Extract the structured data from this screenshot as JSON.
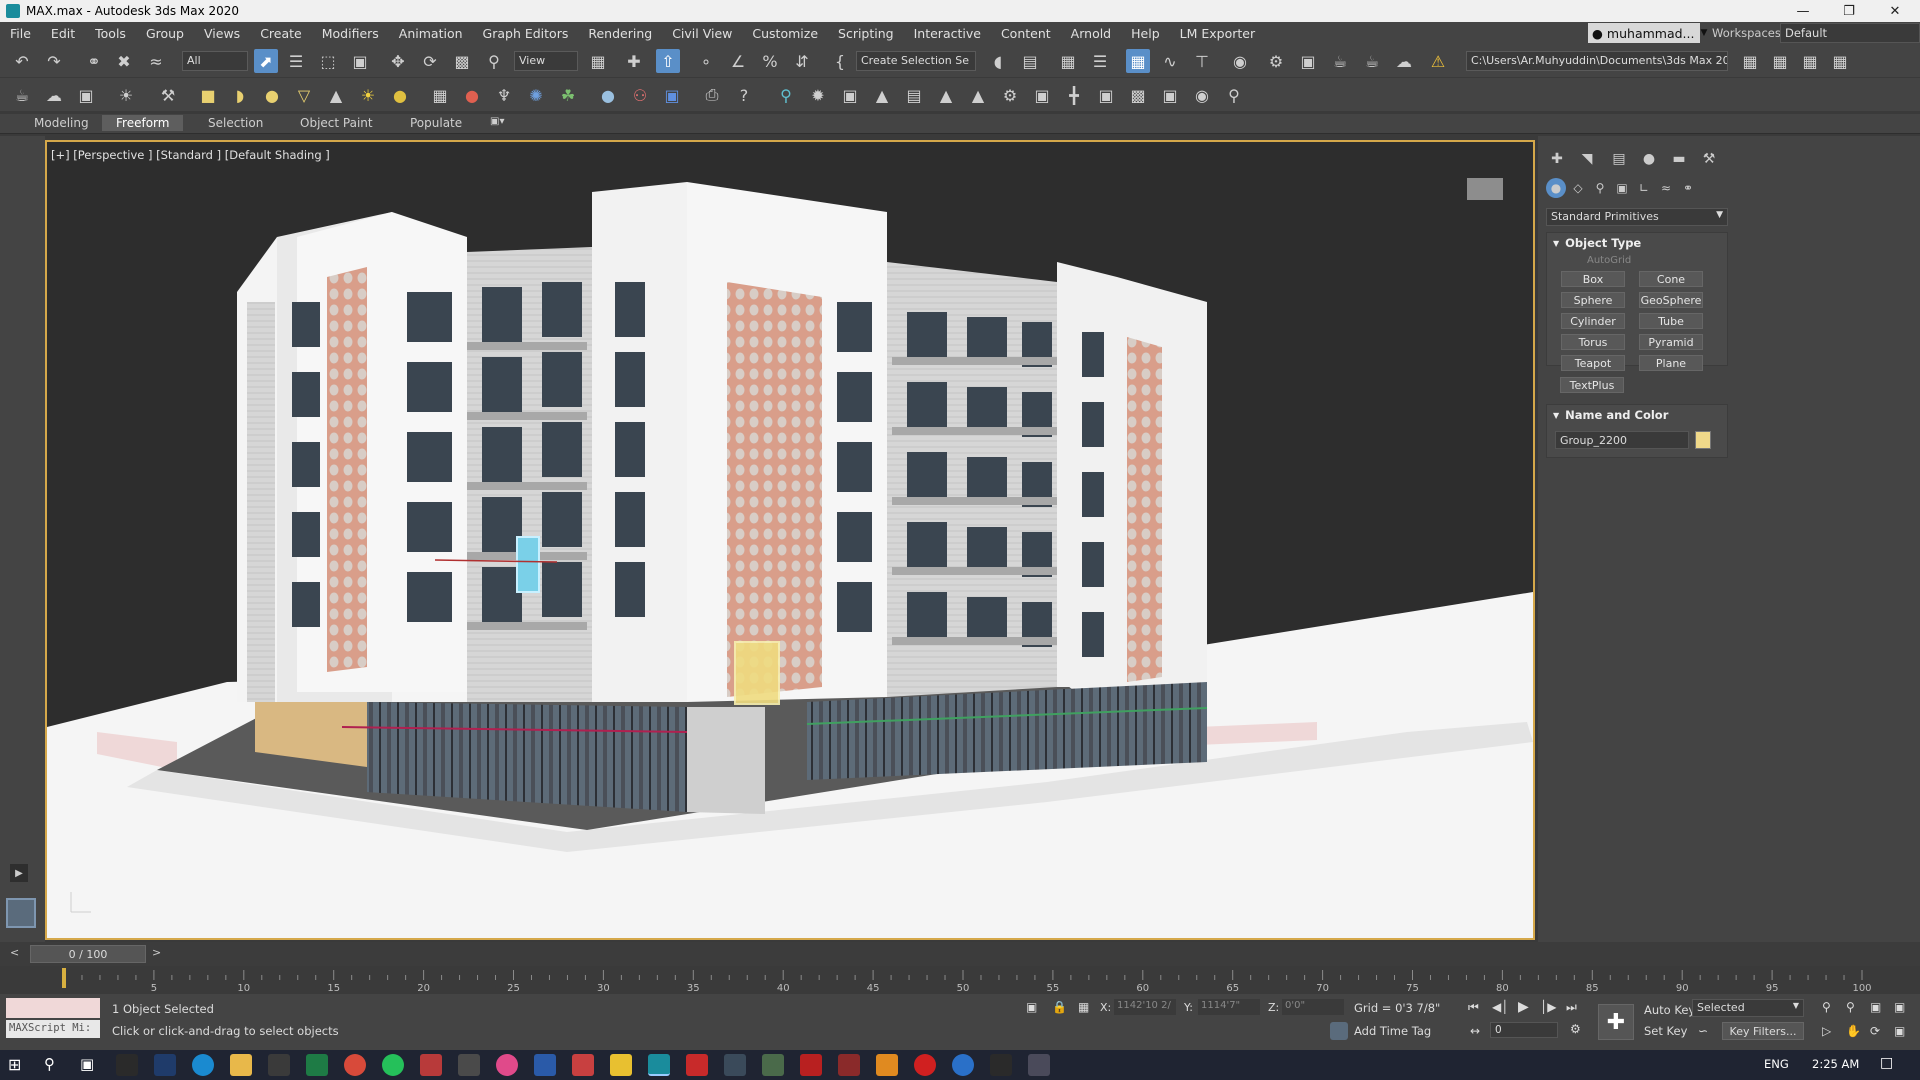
{
  "window": {
    "title": "MAX.max - Autodesk 3ds Max 2020"
  },
  "menu": {
    "items": [
      "File",
      "Edit",
      "Tools",
      "Group",
      "Views",
      "Create",
      "Modifiers",
      "Animation",
      "Graph Editors",
      "Rendering",
      "Civil View",
      "Customize",
      "Scripting",
      "Interactive",
      "Content",
      "Arnold",
      "Help",
      "LM Exporter"
    ],
    "user": "muhammad...",
    "workspaces_label": "Workspaces:",
    "workspaces_value": "Default"
  },
  "toolbar": {
    "filter": "All",
    "ref_coord": "View",
    "selection_set": "Create Selection Se",
    "project_path": "C:\\Users\\Ar.Muhyuddin\\Documents\\3ds Max 2020"
  },
  "ribbon": {
    "tabs": [
      "Modeling",
      "Freeform",
      "Selection",
      "Object Paint",
      "Populate"
    ],
    "active": "Freeform"
  },
  "viewport": {
    "label": "[+] [Perspective ] [Standard ] [Default Shading ]"
  },
  "command_panel": {
    "category": "Standard Primitives",
    "object_type_header": "Object Type",
    "autogrid": "AutoGrid",
    "buttons": [
      "Box",
      "Cone",
      "Sphere",
      "GeoSphere",
      "Cylinder",
      "Tube",
      "Torus",
      "Pyramid",
      "Teapot",
      "Plane",
      "TextPlus"
    ],
    "name_color_header": "Name and Color",
    "object_name": "Group_2200",
    "object_color": "#f0d98a"
  },
  "timeline": {
    "frame_display": "0 / 100",
    "ticks": [
      "5",
      "10",
      "15",
      "20",
      "25",
      "30",
      "35",
      "40",
      "45",
      "50",
      "55",
      "60",
      "65",
      "70",
      "75",
      "80",
      "85",
      "90",
      "95",
      "100"
    ]
  },
  "status": {
    "maxscript": "MAXScript Mi:",
    "selected": "1 Object Selected",
    "hint": "Click or click-and-drag to select objects",
    "x_label": "X:",
    "x_value": "1142'10 2/",
    "y_label": "Y:",
    "y_value": "1114'7\"",
    "z_label": "Z:",
    "z_value": "0'0\"",
    "grid": "Grid = 0'3 7/8\"",
    "add_time_tag": "Add Time Tag",
    "auto_key": "Auto Key",
    "set_key": "Set Key",
    "selected_dd": "Selected",
    "frame_field": "0",
    "key_filters": "Key Filters..."
  },
  "taskbar": {
    "lang": "ENG",
    "time": "2:25 AM"
  }
}
